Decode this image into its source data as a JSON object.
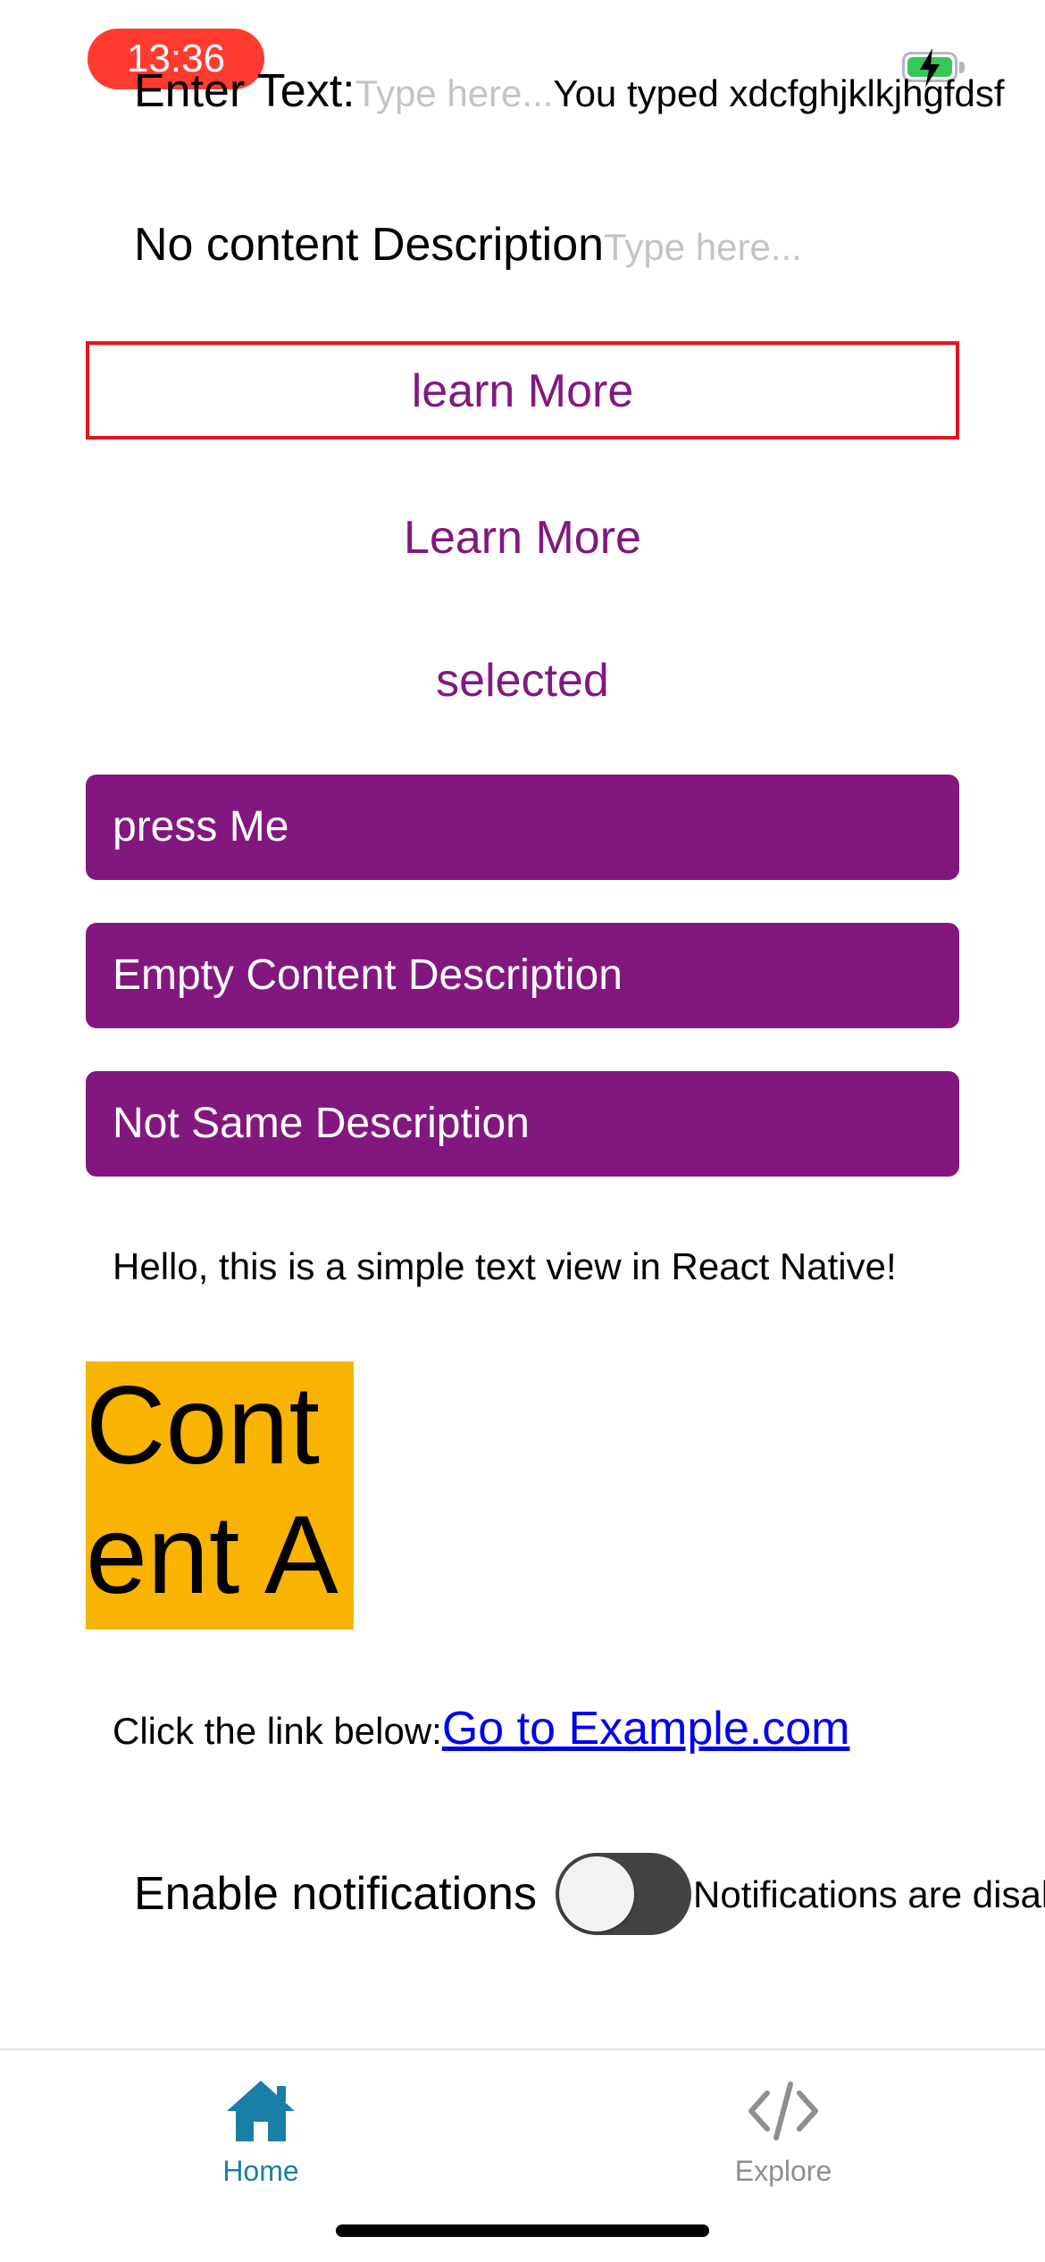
{
  "status_bar": {
    "time": "13:36"
  },
  "enter_text": {
    "label": "Enter Text:",
    "placeholder": "Type here...",
    "echo": "You typed xdcfghjklkjhgfdsf"
  },
  "no_content": {
    "label": "No content Description",
    "placeholder": "Type here..."
  },
  "buttons": {
    "learn_more_outlined": "learn More",
    "learn_more": "Learn More",
    "selected": "selected",
    "press_me": "press Me",
    "empty_content": "Empty Content Description",
    "not_same": "Not Same Description"
  },
  "hello_text": "Hello, this is a simple text view in React Native!",
  "content_area": "Content Ar",
  "link_row": {
    "prefix": "Click the link below:",
    "link_text": "Go to Example.com"
  },
  "notifications": {
    "label": "Enable notifications",
    "status": "Notifications are disabled",
    "enabled": false
  },
  "tabbar": {
    "tabs": [
      {
        "label": "Home",
        "icon": "home-icon",
        "active": true
      },
      {
        "label": "Explore",
        "icon": "code-icon",
        "active": false
      }
    ],
    "active_color": "#1a7fa6",
    "inactive_color": "#8e8e93"
  },
  "colors": {
    "accent": "#82187f",
    "highlight_border": "#e5131f",
    "content_bg": "#f8b400"
  }
}
